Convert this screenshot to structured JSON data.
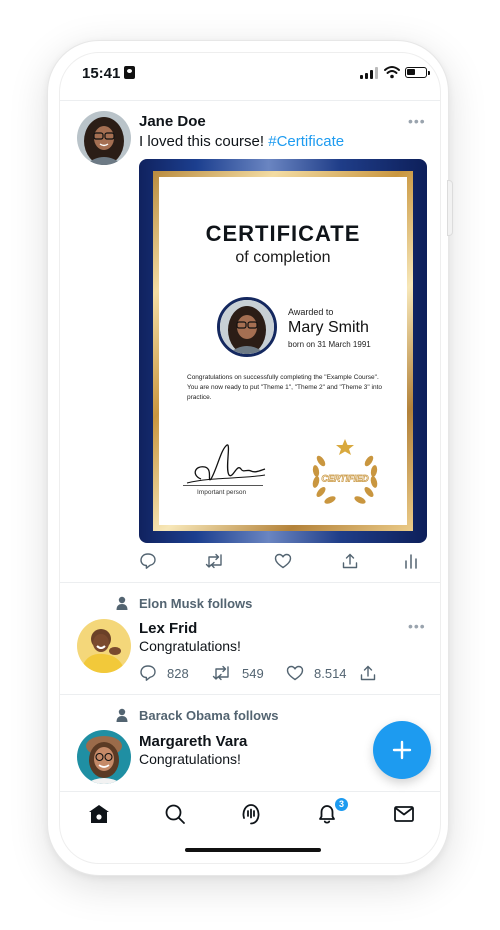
{
  "status_bar": {
    "time": "15:41"
  },
  "tweets": [
    {
      "name": "Jane Doe",
      "text": "I loved this course! ",
      "hashtag": "#Certificate",
      "more": "•••",
      "certificate": {
        "title": "CERTIFICATE",
        "subtitle": "of completion",
        "awarded_label": "Awarded to",
        "recipient": "Mary Smith",
        "born": "born on 31 March 1991",
        "body": "Congratulations on successfully completing the \"Example Course\". You are now ready to put \"Theme 1\", \"Theme 2\" and \"Theme 3\" into practice.",
        "signer": "Important person",
        "seal_text": "CERTIFIED"
      }
    },
    {
      "followed_by": "Elon Musk follows",
      "name": "Lex Frid",
      "text": "Congratulations!",
      "more": "•••",
      "stats": {
        "replies": "828",
        "retweets": "549",
        "likes": "8.514"
      }
    },
    {
      "followed_by": "Barack Obama follows",
      "name": "Margareth Vara",
      "text": "Congratulations!"
    }
  ],
  "tab_bar": {
    "items": [
      "home-icon",
      "search-icon",
      "spaces-icon",
      "notifications-icon",
      "messages-icon"
    ],
    "notification_count": "3"
  },
  "colors": {
    "accent": "#1d9bf0",
    "cert_blue": "#14285f",
    "cert_gold": "#c9963f"
  }
}
